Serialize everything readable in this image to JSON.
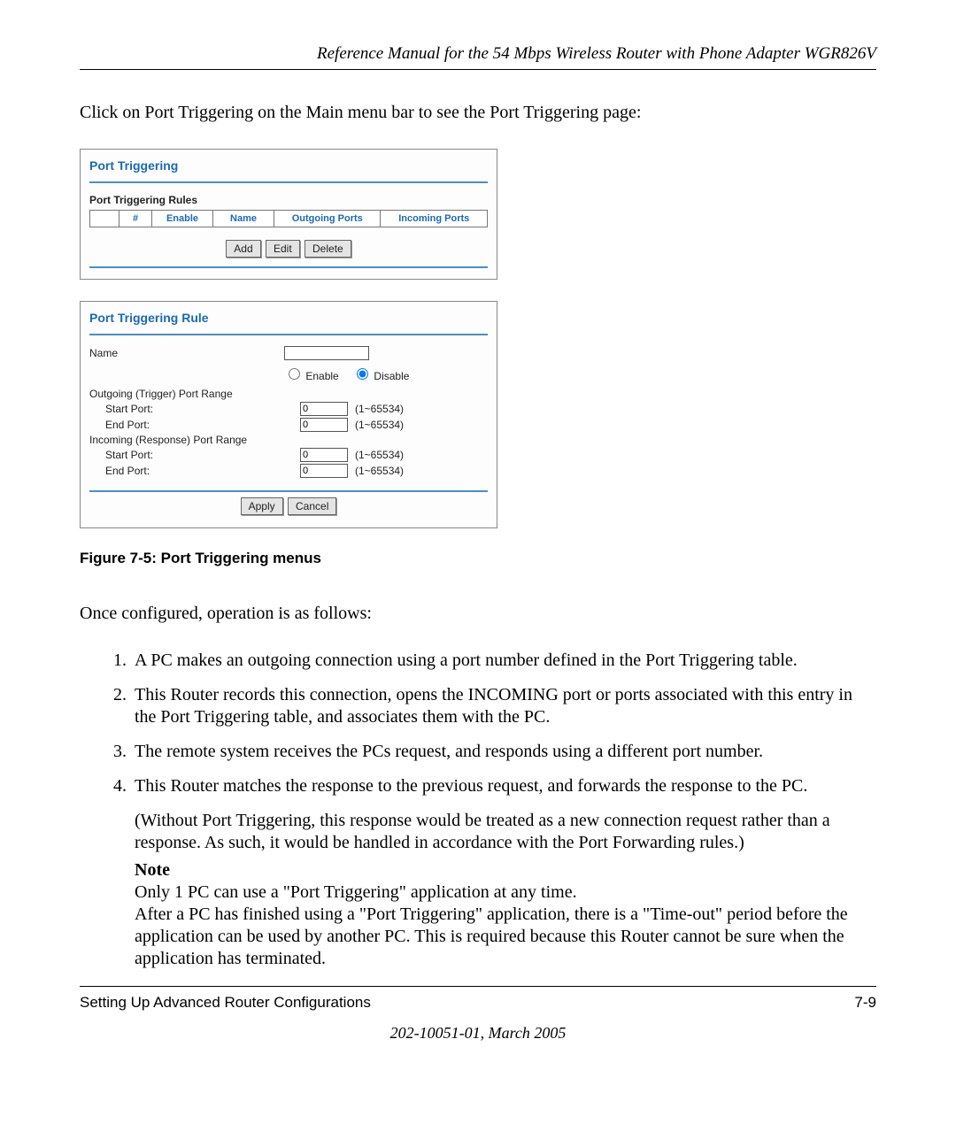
{
  "header": {
    "running": "Reference Manual for the 54 Mbps Wireless Router with Phone Adapter WGR826V"
  },
  "intro": "Click on Port Triggering on the Main menu bar to see the Port Triggering page:",
  "shot1": {
    "title": "Port Triggering",
    "subtitle": "Port Triggering Rules",
    "cols": {
      "num": "#",
      "enable": "Enable",
      "name": "Name",
      "outgoing": "Outgoing Ports",
      "incoming": "Incoming Ports"
    },
    "buttons": {
      "add": "Add",
      "edit": "Edit",
      "delete": "Delete"
    }
  },
  "shot2": {
    "title": "Port Triggering Rule",
    "labels": {
      "name": "Name",
      "enable": "Enable",
      "disable": "Disable",
      "outgoing": "Outgoing (Trigger) Port Range",
      "incoming": "Incoming (Response) Port Range",
      "start": "Start Port:",
      "end": "End Port:",
      "hint": "(1~65534)"
    },
    "values": {
      "name": "",
      "out_start": "0",
      "out_end": "0",
      "in_start": "0",
      "in_end": "0"
    },
    "buttons": {
      "apply": "Apply",
      "cancel": "Cancel"
    }
  },
  "caption": "Figure 7-5:  Port Triggering menus",
  "after": "Once configured, operation is as follows:",
  "steps": {
    "s1": "A PC makes an outgoing connection using a port number defined in the Port Triggering table.",
    "s2": "This Router records this connection, opens the INCOMING port or ports associated with this entry in the Port Triggering table, and associates them with the PC.",
    "s3": "The remote system receives the PCs request, and responds using a different port number.",
    "s4": "This Router matches the response to the previous request, and forwards the response to the PC.",
    "s4b": "(Without Port Triggering, this response would be treated as a new connection request rather than a response. As such, it would be handled in accordance with the Port Forwarding rules.)",
    "noteLabel": "Note",
    "note": "Only 1 PC can use a \"Port Triggering\" application at any time.\nAfter a PC has finished using a \"Port Triggering\" application, there is a \"Time-out\" period before the application can be used by another PC. This is required because this Router cannot be sure when the application has terminated."
  },
  "footer": {
    "left": "Setting Up Advanced Router Configurations",
    "right": "7-9",
    "docid": "202-10051-01, March 2005"
  }
}
